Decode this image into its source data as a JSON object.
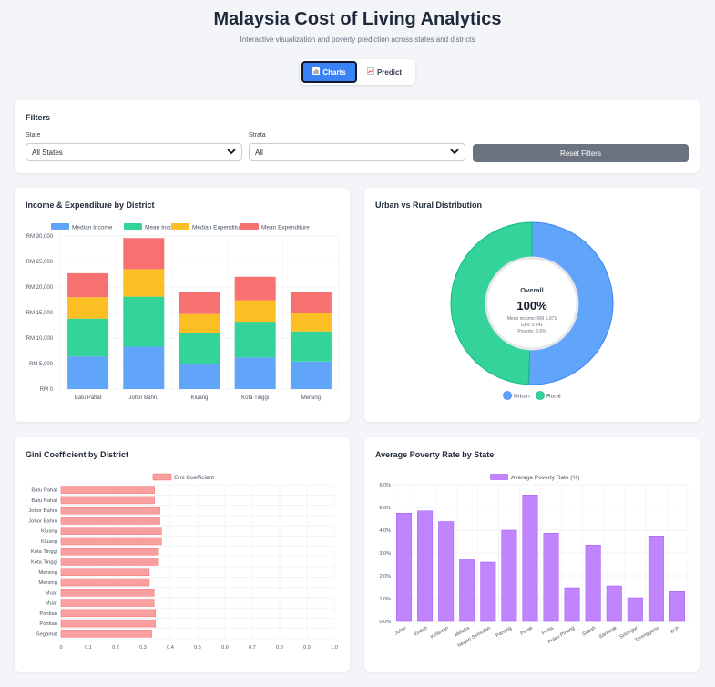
{
  "header": {
    "title": "Malaysia Cost of Living Analytics",
    "subtitle": "Interactive visualization and poverty prediction across states and districts"
  },
  "tabs": [
    {
      "label": "Charts",
      "icon": "bar-chart-icon",
      "active": true
    },
    {
      "label": "Predict",
      "icon": "trend-chart-icon",
      "active": false
    }
  ],
  "filters": {
    "title": "Filters",
    "state_label": "State",
    "state_value": "All States",
    "strata_label": "Strata",
    "strata_value": "All",
    "reset_label": "Reset Filters"
  },
  "colors": {
    "median_income": "#60a5fa",
    "mean_income": "#34d399",
    "median_expenditure": "#fbbf24",
    "mean_expenditure": "#f87171",
    "urban": "#60a5fa",
    "rural": "#34d399",
    "gini": "#f99f9f",
    "poverty": "#c084fc"
  },
  "chart_data": [
    {
      "type": "bar",
      "stacked": true,
      "title": "Income & Expenditure by District",
      "categories": [
        "Batu Pahat",
        "Johor Bahru",
        "Kluang",
        "Kota Tinggi",
        "Mersing"
      ],
      "series": [
        {
          "name": "Median Income",
          "values": [
            6400,
            8300,
            5000,
            6200,
            5400
          ]
        },
        {
          "name": "Mean Income",
          "values": [
            7400,
            9800,
            6000,
            7000,
            5900
          ]
        },
        {
          "name": "Median Expenditure",
          "values": [
            4200,
            5400,
            3700,
            4200,
            3700
          ]
        },
        {
          "name": "Mean Expenditure",
          "values": [
            4700,
            6100,
            4400,
            4600,
            4100
          ]
        }
      ],
      "ylim": [
        0,
        30000
      ],
      "yticks": [
        "RM 0",
        "RM 5,000",
        "RM 10,000",
        "RM 15,000",
        "RM 20,000",
        "RM 25,000",
        "RM 30,000"
      ],
      "legend": "top"
    },
    {
      "type": "pie",
      "donut": true,
      "title": "Urban vs Rural Distribution",
      "categories": [
        "Urban",
        "Rural"
      ],
      "values": [
        50.7,
        49.3
      ],
      "center": {
        "heading": "Overall",
        "value": "100%",
        "lines": [
          "Mean income: RM 5,971",
          "Gini: 0.341",
          "Poverty: 3.6%"
        ]
      },
      "legend": "bottom"
    },
    {
      "type": "bar",
      "orientation": "horizontal",
      "title": "Gini Coefficient by District",
      "series_name": "Gini Coefficient",
      "categories": [
        "Batu Pahat",
        "Batu Pahat",
        "Johor Bahru",
        "Johor Bahru",
        "Kluang",
        "Kluang",
        "Kota Tinggi",
        "Kota Tinggi",
        "Mersing",
        "Mersing",
        "Muar",
        "Muar",
        "Pontian",
        "Pontian",
        "Segamat"
      ],
      "values": [
        0.342,
        0.342,
        0.362,
        0.362,
        0.368,
        0.368,
        0.357,
        0.357,
        0.323,
        0.323,
        0.341,
        0.341,
        0.346,
        0.346,
        0.332
      ],
      "xlim": [
        0,
        1.0
      ],
      "xticks": [
        "0",
        "0.1",
        "0.2",
        "0.3",
        "0.4",
        "0.5",
        "0.6",
        "0.7",
        "0.8",
        "0.9",
        "1.0"
      ],
      "legend": "top"
    },
    {
      "type": "bar",
      "title": "Average Poverty Rate by State",
      "series_name": "Average Poverty Rate (%)",
      "categories": [
        "Johor",
        "Kedah",
        "Kelantan",
        "Melaka",
        "Negeri Sembilan",
        "Pahang",
        "Perak",
        "Perlis",
        "Pulau Pinang",
        "Sabah",
        "Sarawak",
        "Selangor",
        "Terengganu",
        "W.P."
      ],
      "values": [
        4.75,
        4.85,
        4.38,
        2.75,
        2.6,
        4.0,
        5.55,
        3.87,
        1.48,
        3.35,
        1.56,
        1.04,
        3.75,
        1.31
      ],
      "ylim": [
        0,
        6
      ],
      "yticks": [
        "0.0%",
        "1.0%",
        "2.0%",
        "3.0%",
        "4.0%",
        "5.0%",
        "6.0%"
      ],
      "legend": "top"
    }
  ]
}
